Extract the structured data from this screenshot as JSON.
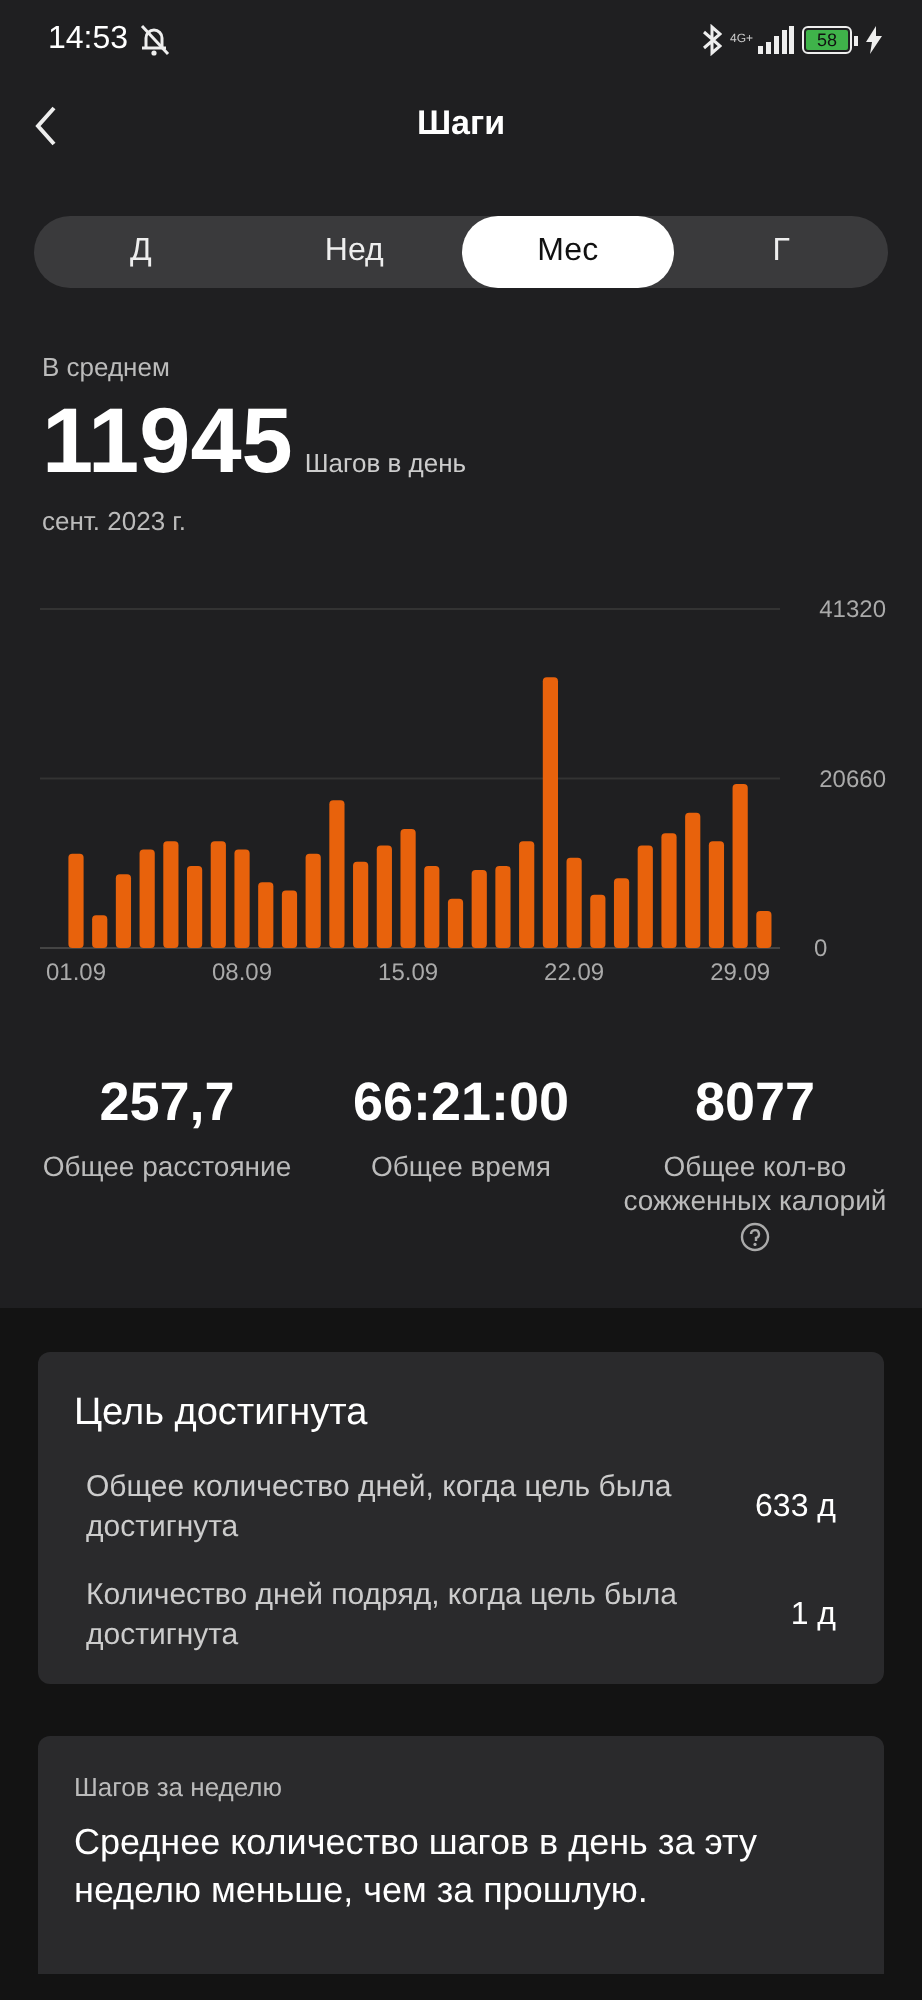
{
  "status_bar": {
    "time": "14:53",
    "network": "4G+",
    "battery": "58"
  },
  "header": {
    "title": "Шаги"
  },
  "tabs": [
    {
      "label": "Д",
      "selected": false
    },
    {
      "label": "Нед",
      "selected": false
    },
    {
      "label": "Мес",
      "selected": true
    },
    {
      "label": "Г",
      "selected": false
    }
  ],
  "summary": {
    "caption": "В среднем",
    "value": "11945",
    "unit": "Шагов в день",
    "period": "сент. 2023 г."
  },
  "chart": {
    "chart_data": {
      "type": "bar",
      "categories": [
        "01.09",
        null,
        null,
        null,
        null,
        null,
        null,
        "08.09",
        null,
        null,
        null,
        null,
        null,
        null,
        "15.09",
        null,
        null,
        null,
        null,
        null,
        null,
        "22.09",
        null,
        null,
        null,
        null,
        null,
        null,
        "29.09",
        null
      ],
      "series": [
        {
          "color": "#e8620c",
          "values": [
            11500,
            4000,
            9000,
            12000,
            13000,
            10000,
            13000,
            12000,
            8000,
            7000,
            11500,
            18000,
            10500,
            12500,
            14500,
            10000,
            6000,
            9500,
            10000,
            13000,
            33000,
            11000,
            6500,
            8500,
            12500,
            14000,
            16500,
            13000,
            20000,
            4500
          ]
        }
      ],
      "ylim": [
        0,
        41320
      ],
      "yticks": [
        0,
        20660,
        41320
      ]
    }
  },
  "stats": [
    {
      "value": "257,7",
      "label": "Общее расстояние",
      "has_help": false
    },
    {
      "value": "66:21:00",
      "label": "Общее время",
      "has_help": false
    },
    {
      "value": "8077",
      "label": "Общее кол-во сожженных калорий",
      "has_help": true
    }
  ],
  "goal_card": {
    "title": "Цель достигнута",
    "rows": [
      {
        "label": "Общее количество дней, когда цель была достигнута",
        "value": "633 д"
      },
      {
        "label": "Количество дней подряд, когда цель была достигнута",
        "value": "1 д"
      }
    ]
  },
  "week_card": {
    "caption": "Шагов за неделю",
    "text": "Среднее количество шагов в день за эту неделю меньше, чем за прошлую."
  }
}
